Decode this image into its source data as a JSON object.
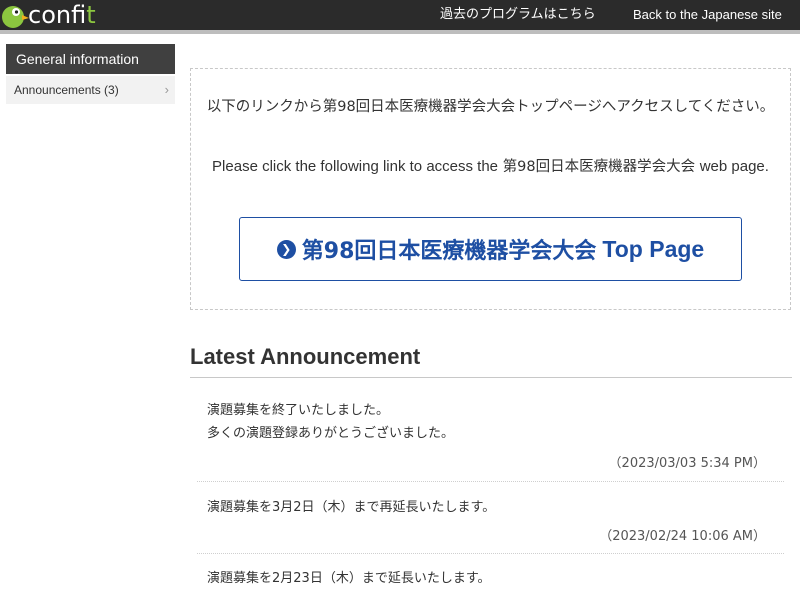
{
  "header": {
    "logo": {
      "text_main": "conf",
      "text_accent": "it"
    },
    "past_program_link": "過去のプログラムはこちら",
    "back_link": "Back to the Japanese site"
  },
  "sidebar": {
    "heading": "General information",
    "items": [
      {
        "label": "Announcements (3)"
      }
    ]
  },
  "link_box": {
    "jp_text": "以下のリンクから第98回日本医療機器学会大会トップページへアクセスしてください。",
    "en_text_prefix": "Please click the following link to access the",
    "en_text_name": "第98回日本医療機器学会大会",
    "en_text_suffix": "web page.",
    "button_name": "第98回日本医療機器学会大会",
    "button_suffix": "Top Page"
  },
  "announcements": {
    "title": "Latest Announcement",
    "items": [
      {
        "line1": "演題募集を終了いたしました。",
        "line2": "多くの演題登録ありがとうございました。",
        "date": "（2023/03/03 5:34 PM）"
      },
      {
        "line1": "演題募集を3月2日（木）まで再延長いたします。",
        "date": "（2023/02/24 10:06 AM）"
      },
      {
        "line1": "演題募集を2月23日（木）まで延長いたします。"
      }
    ]
  },
  "colors": {
    "header_bg": "#2b2b2b",
    "accent_green": "#8cc63f",
    "link_blue": "#1e4fa3",
    "sidebar_head": "#404040"
  },
  "icons": {
    "logo": "duck-logo-icon",
    "chevron": "chevron-right-icon",
    "arrow": "circle-arrow-right-icon"
  }
}
